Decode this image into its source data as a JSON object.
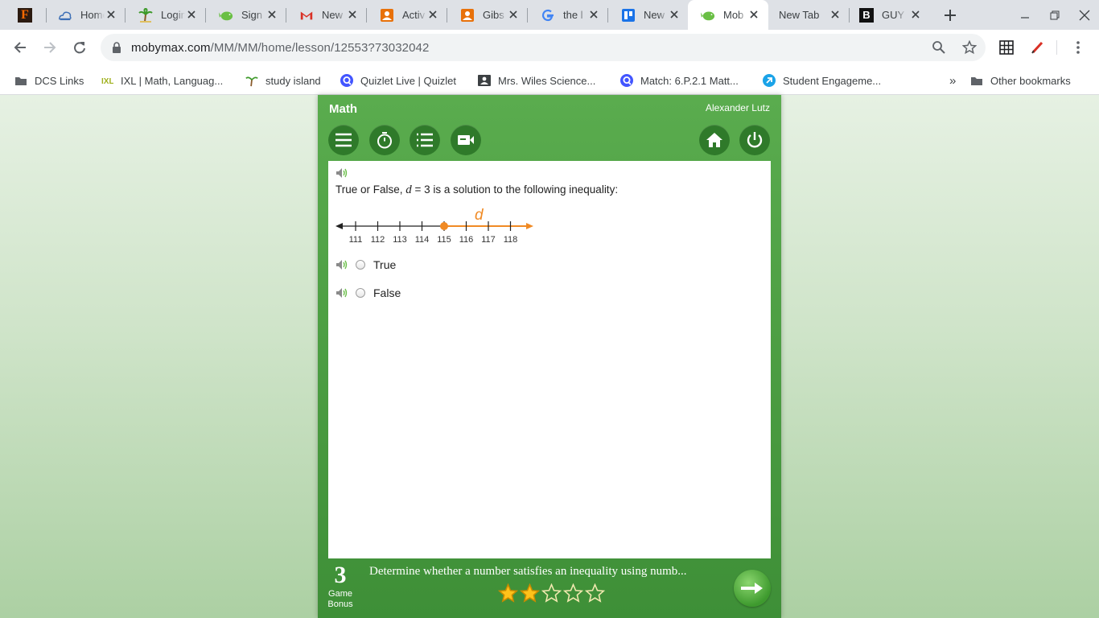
{
  "browser": {
    "tabs": [
      {
        "label": "",
        "icon": "f-icon"
      },
      {
        "label": "Home",
        "icon": "cloud-icon"
      },
      {
        "label": "Login",
        "icon": "palm-tree-icon"
      },
      {
        "label": "Sign",
        "icon": "mobymax-icon"
      },
      {
        "label": "New",
        "icon": "gmail-icon"
      },
      {
        "label": "Activ",
        "icon": "classroom-icon"
      },
      {
        "label": "Gibs",
        "icon": "classroom-icon"
      },
      {
        "label": "the l",
        "icon": "google-icon"
      },
      {
        "label": "New",
        "icon": "docs-icon"
      },
      {
        "label": "Mob",
        "icon": "mobymax-icon",
        "active": true
      },
      {
        "label": "New Tab",
        "icon": ""
      },
      {
        "label": "GUY",
        "icon": "b-icon"
      }
    ],
    "address": {
      "host": "mobymax.com",
      "path": "/MM/MM/home/lesson/12553?73032042"
    },
    "bookmarks": [
      {
        "label": "DCS Links",
        "icon": "folder-icon"
      },
      {
        "label": "IXL | Math, Languag...",
        "icon": "ixl-icon"
      },
      {
        "label": "study island",
        "icon": "palm-tree-icon"
      },
      {
        "label": "Quizlet Live | Quizlet",
        "icon": "quizlet-icon"
      },
      {
        "label": "Mrs. Wiles Science...",
        "icon": "contact-icon"
      },
      {
        "label": "Match: 6.P.2.1 Matt...",
        "icon": "quizlet-icon"
      },
      {
        "label": "Student Engageme...",
        "icon": "engage-icon"
      }
    ],
    "overflow": "»",
    "other_bookmarks": "Other bookmarks"
  },
  "app": {
    "title": "Math",
    "user": "Alexander Lutz",
    "question": {
      "prefix": "True or False, ",
      "variable": "d",
      "suffix": " = 3 is a solution to the following inequality:"
    },
    "number_line": {
      "variable": "d",
      "ticks": [
        "111",
        "112",
        "113",
        "114",
        "115",
        "116",
        "117",
        "118"
      ],
      "point": 115,
      "direction": "right",
      "closed": true
    },
    "choices": [
      "True",
      "False"
    ],
    "footer": {
      "bonus_number": "3",
      "bonus_label_1": "Game",
      "bonus_label_2": "Bonus",
      "lesson_title": "Determine whether a number satisfies an inequality using numb...",
      "stars_filled": 2,
      "stars_total": 5
    }
  },
  "colors": {
    "accent_orange": "#f08a24",
    "app_green": "#4a9e40",
    "button_green": "#2f7a2a"
  }
}
